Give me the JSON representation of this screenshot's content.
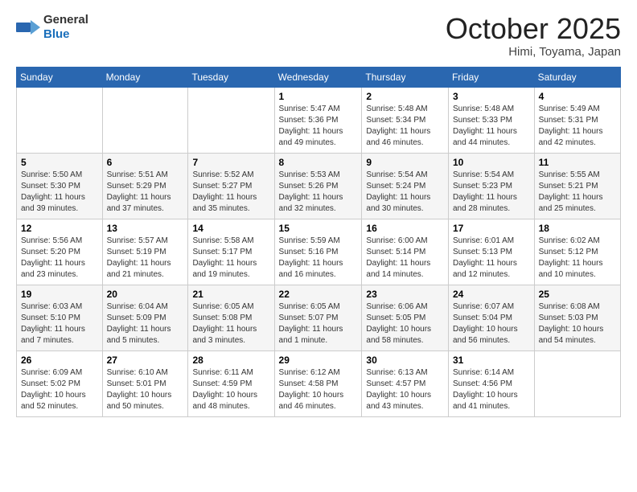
{
  "header": {
    "logo_general": "General",
    "logo_blue": "Blue",
    "title": "October 2025",
    "subtitle": "Himi, Toyama, Japan"
  },
  "days_of_week": [
    "Sunday",
    "Monday",
    "Tuesday",
    "Wednesday",
    "Thursday",
    "Friday",
    "Saturday"
  ],
  "weeks": [
    [
      {
        "day": "",
        "detail": ""
      },
      {
        "day": "",
        "detail": ""
      },
      {
        "day": "",
        "detail": ""
      },
      {
        "day": "1",
        "detail": "Sunrise: 5:47 AM\nSunset: 5:36 PM\nDaylight: 11 hours\nand 49 minutes."
      },
      {
        "day": "2",
        "detail": "Sunrise: 5:48 AM\nSunset: 5:34 PM\nDaylight: 11 hours\nand 46 minutes."
      },
      {
        "day": "3",
        "detail": "Sunrise: 5:48 AM\nSunset: 5:33 PM\nDaylight: 11 hours\nand 44 minutes."
      },
      {
        "day": "4",
        "detail": "Sunrise: 5:49 AM\nSunset: 5:31 PM\nDaylight: 11 hours\nand 42 minutes."
      }
    ],
    [
      {
        "day": "5",
        "detail": "Sunrise: 5:50 AM\nSunset: 5:30 PM\nDaylight: 11 hours\nand 39 minutes."
      },
      {
        "day": "6",
        "detail": "Sunrise: 5:51 AM\nSunset: 5:29 PM\nDaylight: 11 hours\nand 37 minutes."
      },
      {
        "day": "7",
        "detail": "Sunrise: 5:52 AM\nSunset: 5:27 PM\nDaylight: 11 hours\nand 35 minutes."
      },
      {
        "day": "8",
        "detail": "Sunrise: 5:53 AM\nSunset: 5:26 PM\nDaylight: 11 hours\nand 32 minutes."
      },
      {
        "day": "9",
        "detail": "Sunrise: 5:54 AM\nSunset: 5:24 PM\nDaylight: 11 hours\nand 30 minutes."
      },
      {
        "day": "10",
        "detail": "Sunrise: 5:54 AM\nSunset: 5:23 PM\nDaylight: 11 hours\nand 28 minutes."
      },
      {
        "day": "11",
        "detail": "Sunrise: 5:55 AM\nSunset: 5:21 PM\nDaylight: 11 hours\nand 25 minutes."
      }
    ],
    [
      {
        "day": "12",
        "detail": "Sunrise: 5:56 AM\nSunset: 5:20 PM\nDaylight: 11 hours\nand 23 minutes."
      },
      {
        "day": "13",
        "detail": "Sunrise: 5:57 AM\nSunset: 5:19 PM\nDaylight: 11 hours\nand 21 minutes."
      },
      {
        "day": "14",
        "detail": "Sunrise: 5:58 AM\nSunset: 5:17 PM\nDaylight: 11 hours\nand 19 minutes."
      },
      {
        "day": "15",
        "detail": "Sunrise: 5:59 AM\nSunset: 5:16 PM\nDaylight: 11 hours\nand 16 minutes."
      },
      {
        "day": "16",
        "detail": "Sunrise: 6:00 AM\nSunset: 5:14 PM\nDaylight: 11 hours\nand 14 minutes."
      },
      {
        "day": "17",
        "detail": "Sunrise: 6:01 AM\nSunset: 5:13 PM\nDaylight: 11 hours\nand 12 minutes."
      },
      {
        "day": "18",
        "detail": "Sunrise: 6:02 AM\nSunset: 5:12 PM\nDaylight: 11 hours\nand 10 minutes."
      }
    ],
    [
      {
        "day": "19",
        "detail": "Sunrise: 6:03 AM\nSunset: 5:10 PM\nDaylight: 11 hours\nand 7 minutes."
      },
      {
        "day": "20",
        "detail": "Sunrise: 6:04 AM\nSunset: 5:09 PM\nDaylight: 11 hours\nand 5 minutes."
      },
      {
        "day": "21",
        "detail": "Sunrise: 6:05 AM\nSunset: 5:08 PM\nDaylight: 11 hours\nand 3 minutes."
      },
      {
        "day": "22",
        "detail": "Sunrise: 6:05 AM\nSunset: 5:07 PM\nDaylight: 11 hours\nand 1 minute."
      },
      {
        "day": "23",
        "detail": "Sunrise: 6:06 AM\nSunset: 5:05 PM\nDaylight: 10 hours\nand 58 minutes."
      },
      {
        "day": "24",
        "detail": "Sunrise: 6:07 AM\nSunset: 5:04 PM\nDaylight: 10 hours\nand 56 minutes."
      },
      {
        "day": "25",
        "detail": "Sunrise: 6:08 AM\nSunset: 5:03 PM\nDaylight: 10 hours\nand 54 minutes."
      }
    ],
    [
      {
        "day": "26",
        "detail": "Sunrise: 6:09 AM\nSunset: 5:02 PM\nDaylight: 10 hours\nand 52 minutes."
      },
      {
        "day": "27",
        "detail": "Sunrise: 6:10 AM\nSunset: 5:01 PM\nDaylight: 10 hours\nand 50 minutes."
      },
      {
        "day": "28",
        "detail": "Sunrise: 6:11 AM\nSunset: 4:59 PM\nDaylight: 10 hours\nand 48 minutes."
      },
      {
        "day": "29",
        "detail": "Sunrise: 6:12 AM\nSunset: 4:58 PM\nDaylight: 10 hours\nand 46 minutes."
      },
      {
        "day": "30",
        "detail": "Sunrise: 6:13 AM\nSunset: 4:57 PM\nDaylight: 10 hours\nand 43 minutes."
      },
      {
        "day": "31",
        "detail": "Sunrise: 6:14 AM\nSunset: 4:56 PM\nDaylight: 10 hours\nand 41 minutes."
      },
      {
        "day": "",
        "detail": ""
      }
    ]
  ]
}
